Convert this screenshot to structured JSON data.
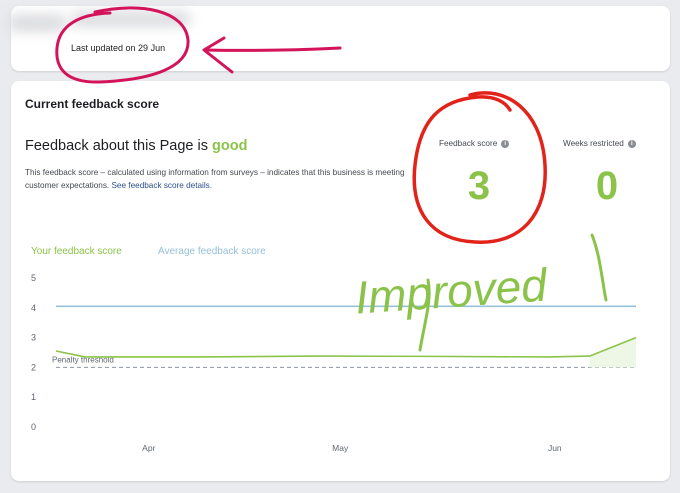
{
  "header": {
    "last_updated": "Last updated on 29 Jun"
  },
  "card": {
    "title": "Current feedback score",
    "headline_prefix": "Feedback about this Page is ",
    "headline_status": "good",
    "description": "This feedback score – calculated using information from surveys – indicates that this business is meeting customer expectations. ",
    "details_link": "See feedback score details."
  },
  "metrics": {
    "feedback_score_label": "Feedback score",
    "feedback_score_value": "3",
    "weeks_restricted_label": "Weeks restricted",
    "weeks_restricted_value": "0"
  },
  "icons": {
    "info": "info-icon"
  },
  "annotation": {
    "handwritten": "Improved"
  },
  "colors": {
    "good": "#8bc34a",
    "average": "#95c1d9",
    "annotation_red": "#e2231a",
    "annotation_magenta": "#d4145a"
  },
  "chart_data": {
    "type": "line",
    "x_ticks": [
      "Apr",
      "May",
      "Jun"
    ],
    "y_ticks": [
      "5",
      "4",
      "3",
      "2",
      "1",
      "0"
    ],
    "ylim": [
      0,
      5
    ],
    "legend": [
      "Your feedback score",
      "Average feedback score"
    ],
    "threshold_label": "Penalty threshold",
    "threshold_value": 2,
    "series": [
      {
        "name": "Your feedback score",
        "color": "#8bc34a",
        "points": [
          [
            0,
            2.55
          ],
          [
            0.05,
            2.35
          ],
          [
            0.25,
            2.35
          ],
          [
            0.45,
            2.38
          ],
          [
            0.65,
            2.37
          ],
          [
            0.85,
            2.35
          ],
          [
            0.92,
            2.38
          ],
          [
            1,
            3.0
          ]
        ]
      },
      {
        "name": "Average feedback score",
        "color": "#95c1d9",
        "points": [
          [
            0,
            4.05
          ],
          [
            1,
            4.05
          ]
        ]
      }
    ]
  }
}
